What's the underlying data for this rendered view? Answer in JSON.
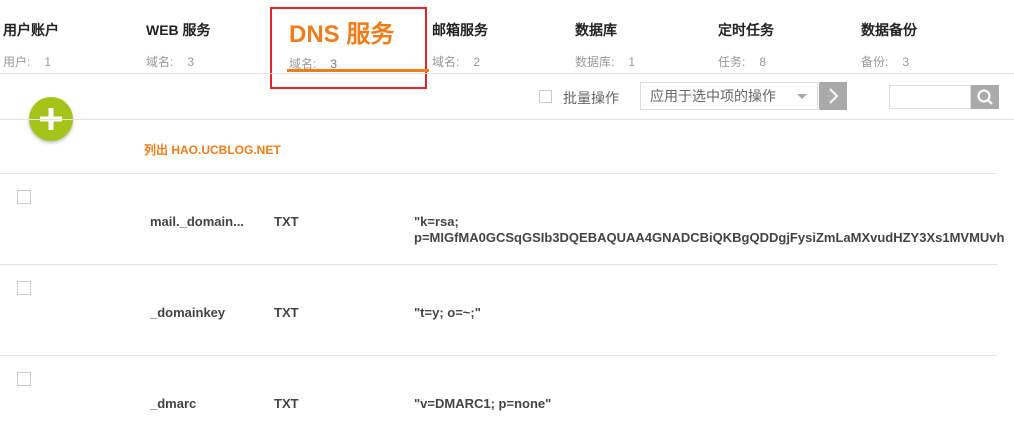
{
  "tabs": [
    {
      "title": "用户账户",
      "count_label": "用户:",
      "count": "1"
    },
    {
      "title": "WEB 服务",
      "count_label": "域名:",
      "count": "3"
    },
    {
      "title": "DNS 服务",
      "count_label": "域名:",
      "count": "3",
      "active": true
    },
    {
      "title": "邮箱服务",
      "count_label": "域名:",
      "count": "2"
    },
    {
      "title": "数据库",
      "count_label": "数据库:",
      "count": "1"
    },
    {
      "title": "定时任务",
      "count_label": "任务:",
      "count": "8"
    },
    {
      "title": "数据备份",
      "count_label": "备份:",
      "count": "3"
    }
  ],
  "toolbar": {
    "add_icon": "plus-icon",
    "bulk_label": "批量操作",
    "action_select_value": "应用于选中项的操作",
    "go_icon": "chevron-right-icon",
    "search_placeholder": "",
    "search_icon": "search-icon"
  },
  "list": {
    "title": "列出 HAO.UCBLOG.NET",
    "records": [
      {
        "name": "mail._domain...",
        "type": "TXT",
        "value_lines": [
          "\"k=rsa;",
          "p=MIGfMA0GCSqGSIb3DQEBAQUAA4GNADCBiQKBgQDDgjFysiZmLaMXvudHZY3Xs1MVMUvh"
        ]
      },
      {
        "name": "_domainkey",
        "type": "TXT",
        "value_lines": [
          "\"t=y; o=~;\""
        ]
      },
      {
        "name": "_dmarc",
        "type": "TXT",
        "value_lines": [
          "\"v=DMARC1; p=none\""
        ]
      }
    ]
  },
  "colors": {
    "accent": "#f07c1a",
    "add_button": "#a5c41a",
    "highlight_border": "#e0252b",
    "button_gray": "#aaaaaa"
  }
}
